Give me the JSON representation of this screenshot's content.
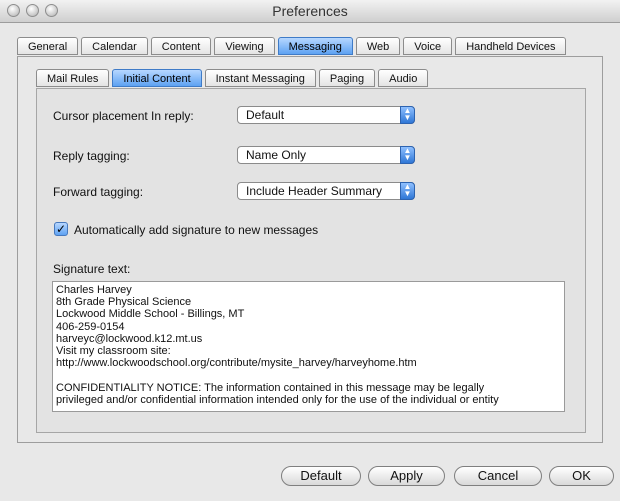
{
  "window": {
    "title": "Preferences"
  },
  "top_tabs": [
    {
      "label": "General"
    },
    {
      "label": "Calendar"
    },
    {
      "label": "Content"
    },
    {
      "label": "Viewing"
    },
    {
      "label": "Messaging"
    },
    {
      "label": "Web"
    },
    {
      "label": "Voice"
    },
    {
      "label": "Handheld Devices"
    }
  ],
  "sub_tabs": [
    {
      "label": "Mail Rules"
    },
    {
      "label": "Initial Content"
    },
    {
      "label": "Instant Messaging"
    },
    {
      "label": "Paging"
    },
    {
      "label": "Audio"
    }
  ],
  "form": {
    "cursor_label": "Cursor placement In reply:",
    "cursor_value": "Default",
    "reply_label": "Reply tagging:",
    "reply_value": "Name Only",
    "forward_label": "Forward tagging:",
    "forward_value": "Include Header Summary",
    "auto_sig_label": "Automatically add signature to new messages",
    "auto_sig_checked": true,
    "sig_text_label": "Signature text:",
    "signature_lines": [
      "Charles Harvey",
      "8th Grade Physical Science",
      "Lockwood Middle School - Billings, MT",
      "406-259-0154",
      "harveyc@lockwood.k12.mt.us",
      "Visit my classroom site:",
      "http://www.lockwoodschool.org/contribute/mysite_harvey/harveyhome.htm",
      "",
      "CONFIDENTIALITY NOTICE:  The information contained in this message may be legally",
      "privileged and/or confidential information intended only for the use of the individual or entity"
    ]
  },
  "buttons": {
    "default": "Default",
    "apply": "Apply",
    "cancel": "Cancel",
    "ok": "OK"
  },
  "colors": {
    "accent_blue": "#5ea2f2",
    "window_bg": "#e8e8e8"
  }
}
